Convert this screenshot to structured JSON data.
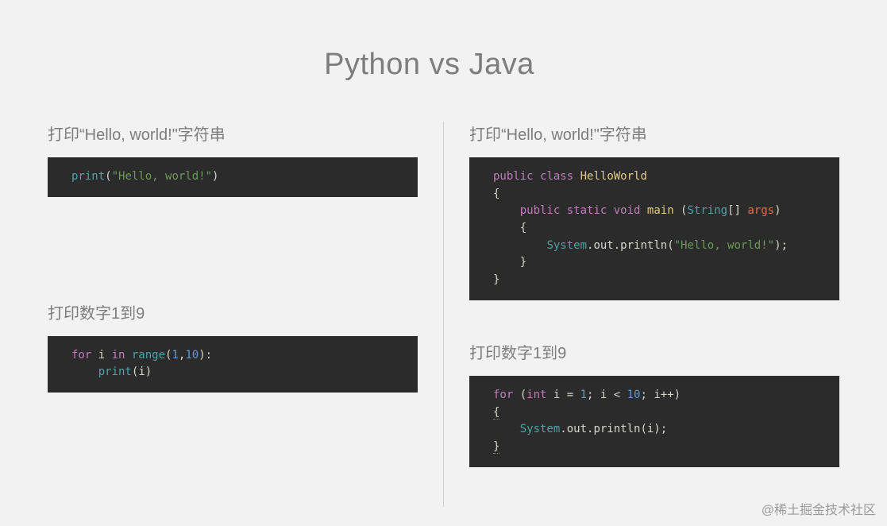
{
  "title": "Python vs Java",
  "watermark": "@稀土掘金技术社区",
  "left": {
    "section1": {
      "title": "打印“Hello, world!\"字符串"
    },
    "section2": {
      "title": "打印数字1到9"
    }
  },
  "right": {
    "section1": {
      "title": "打印“Hello, world!\"字符串"
    },
    "section2": {
      "title": "打印数字1到9"
    }
  },
  "code": {
    "python_hello": {
      "print": "print",
      "lparen": "(",
      "str": "\"Hello, world!\"",
      "rparen": ")"
    },
    "python_loop": {
      "for": "for",
      "i": " i ",
      "in": "in",
      "range": " range",
      "lp": "(",
      "n1": "1",
      "comma": ",",
      "n2": "10",
      "rp": "):",
      "indent": "    ",
      "print": "print",
      "lp2": "(",
      "ivar": "i",
      "rp2": ")"
    },
    "java_hello": {
      "l1_public": "public",
      "l1_sp1": " ",
      "l1_class": "class",
      "l1_sp2": " ",
      "l1_name": "HelloWorld",
      "l2": "{",
      "l3_pad": "    ",
      "l3_public": "public",
      "l3_sp1": " ",
      "l3_static": "static",
      "l3_sp2": " ",
      "l3_void": "void",
      "l3_sp3": " ",
      "l3_main": "main",
      "l3_sp4": " (",
      "l3_String": "String",
      "l3_brackets": "[] ",
      "l3_args": "args",
      "l3_close": ")",
      "l4_pad": "    ",
      "l4": "{",
      "l5_pad": "        ",
      "l5_System": "System",
      "l5_dot1": ".out.",
      "l5_println": "println",
      "l5_lp": "(",
      "l5_str": "\"Hello, world!\"",
      "l5_rp": ");",
      "l6_pad": "    ",
      "l6": "}",
      "l7": "}"
    },
    "java_loop": {
      "l1_for": "for",
      "l1_sp": " (",
      "l1_int": "int",
      "l1_ieq": " i = ",
      "l1_1": "1",
      "l1_semi1": "; i < ",
      "l1_10": "10",
      "l1_semi2": "; i++)",
      "l2": "{",
      "l3_pad": "    ",
      "l3_System": "System",
      "l3_rest": ".out.println(i);",
      "l4": "}"
    }
  }
}
